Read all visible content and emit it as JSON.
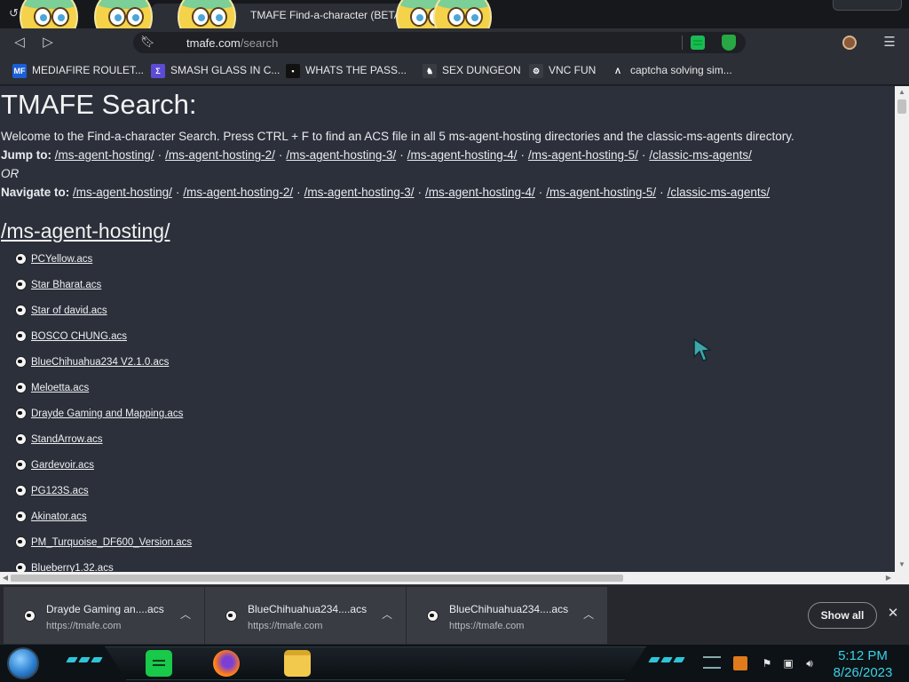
{
  "tab": {
    "title": "TMAFE Find-a-character (BETA)"
  },
  "omnibox": {
    "url_host": "tmafe.com",
    "url_path": "/search"
  },
  "bookmarks": [
    {
      "label": "MEDIAFIRE ROULET...",
      "icon": "mediafire-icon",
      "color": "#1a5fd6",
      "icon_text": "MF"
    },
    {
      "label": "SMASH GLASS IN C...",
      "icon": "shard-icon",
      "color": "#5b4bd6",
      "icon_text": "Σ"
    },
    {
      "label": "WHATS THE PASS...",
      "icon": "notion-icon",
      "color": "#111111",
      "icon_text": "▪"
    },
    {
      "label": "SEX DUNGEON",
      "icon": "chess-knight-icon",
      "color": "#3a3c44",
      "icon_text": "♞"
    },
    {
      "label": "VNC FUN",
      "icon": "gear-icon",
      "color": "#3a3c44",
      "icon_text": "⚙"
    },
    {
      "label": "captcha solving sim...",
      "icon": "a-logo-icon",
      "color": "#2d2f36",
      "icon_text": "Λ"
    }
  ],
  "page": {
    "title": "TMAFE Search:",
    "intro": "Welcome to the Find-a-character Search. Press CTRL + F to find an ACS file in all 5 ms-agent-hosting directories and the classic-ms-agents directory.",
    "jump_label": "Jump to:",
    "or_text": "OR",
    "navigate_label": "Navigate to:",
    "dir_links": [
      "/ms-agent-hosting/",
      "/ms-agent-hosting-2/",
      "/ms-agent-hosting-3/",
      "/ms-agent-hosting-4/",
      "/ms-agent-hosting-5/",
      "/classic-ms-agents/"
    ],
    "section_title": "/ms-agent-hosting/",
    "files": [
      "PCYellow.acs",
      "Star Bharat.acs",
      "Star of david.acs",
      "BOSCO CHUNG.acs",
      "BlueChihuahua234 V2.1.0.acs",
      "Meloetta.acs",
      "Drayde Gaming and Mapping.acs",
      "StandArrow.acs",
      "Gardevoir.acs",
      "PG123S.acs",
      "Akinator.acs",
      "PM_Turquoise_DF600_Version.acs",
      "Blueberry1.32.acs"
    ]
  },
  "downloads": {
    "items": [
      {
        "title": "Drayde Gaming an....acs",
        "source": "https://tmafe.com"
      },
      {
        "title": "BlueChihuahua234....acs",
        "source": "https://tmafe.com"
      },
      {
        "title": "BlueChihuahua234....acs",
        "source": "https://tmafe.com"
      }
    ],
    "show_all_label": "Show all"
  },
  "taskbar": {
    "time": "5:12 PM",
    "date": "8/26/2023"
  },
  "colors": {
    "accent": "#3ad2e6",
    "page_bg": "#2c303a"
  }
}
